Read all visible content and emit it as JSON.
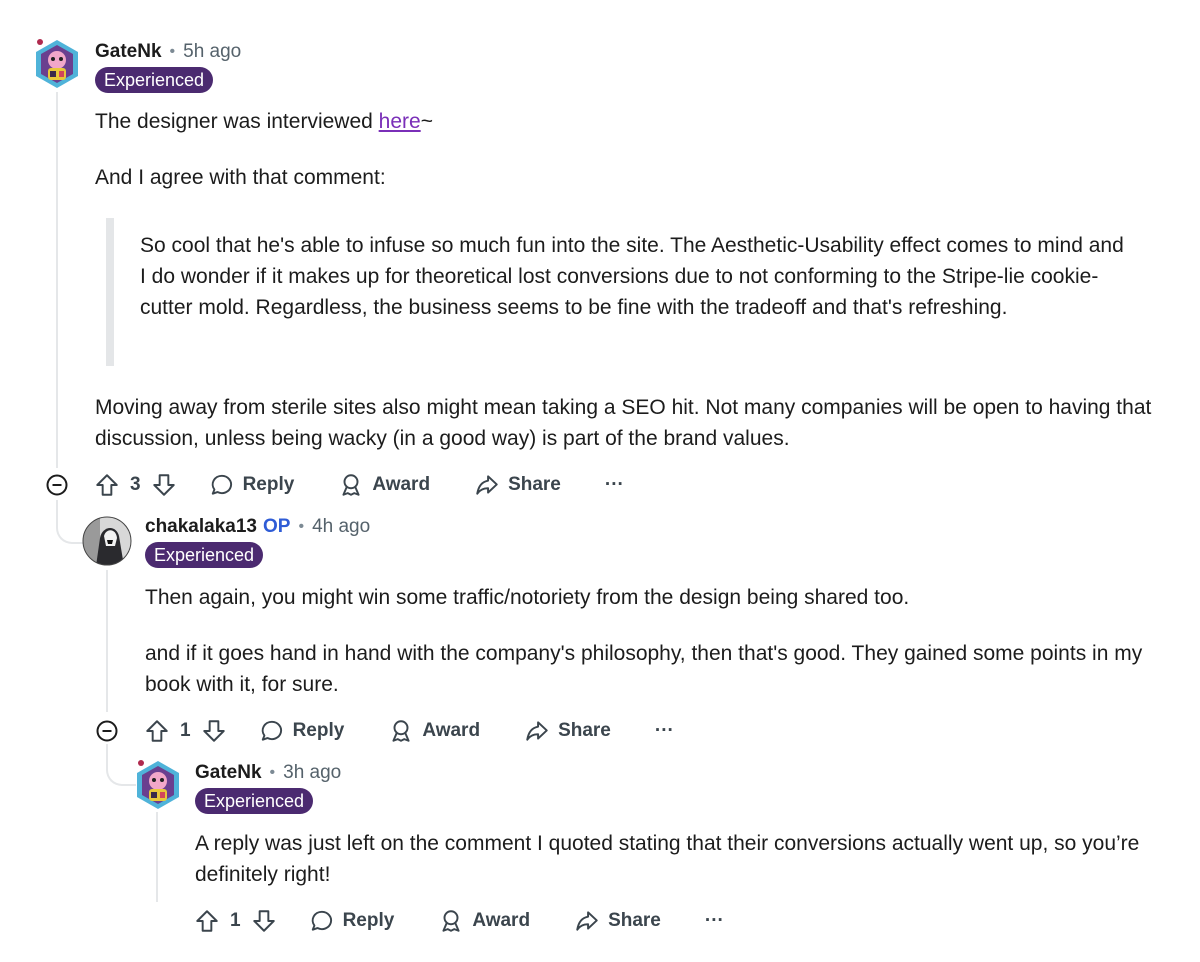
{
  "comments": [
    {
      "username": "GateNk",
      "time": "5h ago",
      "flair": "Experienced",
      "body_intro": "The designer was interviewed ",
      "body_link": "here",
      "body_after_link": "~",
      "body_p2": "And I agree with that comment:",
      "quote": "So cool that he's able to infuse so much fun into the site. The Aesthetic-Usability effect comes to mind and I do wonder if it makes up for theoretical lost conversions due to not conforming to the Stripe-lie cookie-cutter mold. Regardless, the business seems to be fine with the tradeoff and that's refreshing.",
      "body_p3": "Moving away from sterile sites also might mean taking a SEO hit. Not many companies will be open to having that discussion, unless being wacky (in a good way) is part of the brand values.",
      "votes": "3"
    },
    {
      "username": "chakalaka13",
      "op_badge": "OP",
      "time": "4h ago",
      "flair": "Experienced",
      "body_p1": "Then again, you might win some traffic/notoriety from the design being shared too.",
      "body_p2": "and if it goes hand in hand with the company's philosophy, then that's good. They gained some points in my book with it, for sure.",
      "votes": "1"
    },
    {
      "username": "GateNk",
      "time": "3h ago",
      "flair": "Experienced",
      "body_p1": "A reply was just left on the comment I quoted stating that their conversions actually went up, so you’re definitely right!",
      "votes": "1"
    }
  ],
  "actions": {
    "reply": "Reply",
    "award": "Award",
    "share": "Share",
    "more": "···"
  },
  "separator": "•"
}
